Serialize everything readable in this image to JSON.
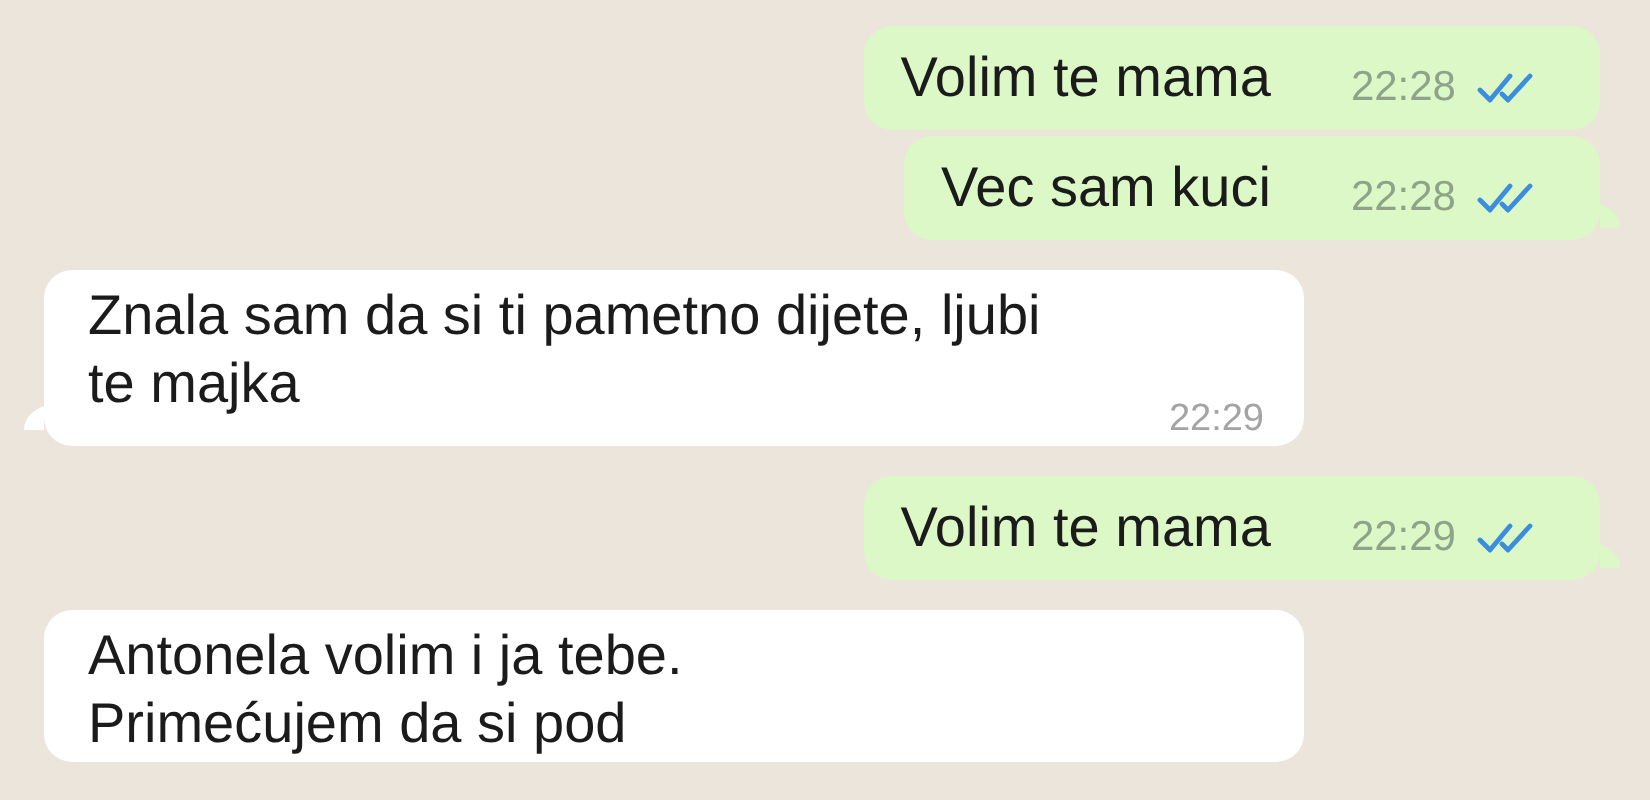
{
  "messages": [
    {
      "kind": "outgoing",
      "lines": [
        "Volim te mama"
      ],
      "time": "22:28",
      "read": true,
      "tail": false
    },
    {
      "kind": "outgoing",
      "lines": [
        "Vec sam kuci"
      ],
      "time": "22:28",
      "read": true,
      "tail": true
    },
    {
      "kind": "incoming",
      "lines": [
        "Znala sam da si ti pametno dijete, ljubi te majka"
      ],
      "time": "22:29",
      "tail": true
    },
    {
      "kind": "outgoing",
      "lines": [
        "Volim te mama"
      ],
      "time": "22:29",
      "read": true,
      "tail": true
    },
    {
      "kind": "incoming",
      "lines": [
        "Antonela volim i ja tebe.",
        "Primećujem da si pod"
      ],
      "tail": false
    }
  ]
}
